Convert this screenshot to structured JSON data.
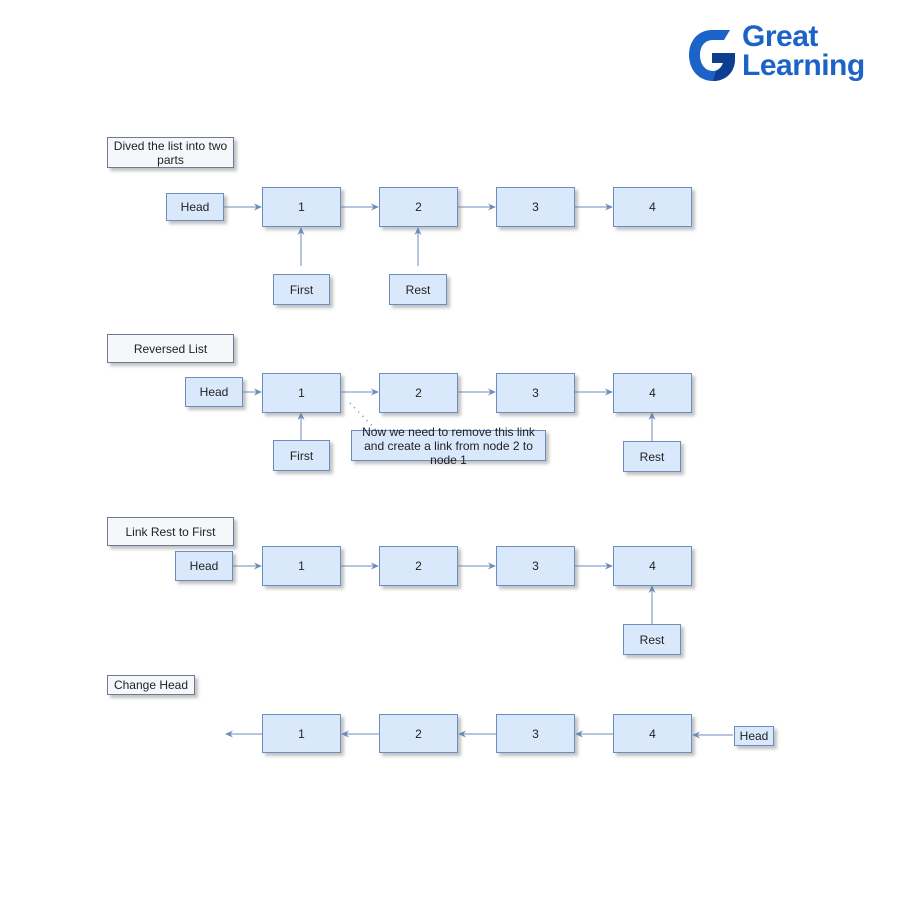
{
  "brand": {
    "name_line1": "Great",
    "name_line2": "Learning",
    "logo_icon": "g-logo-icon",
    "colors": {
      "primary": "#1c63c7",
      "dark": "#0f3d8f",
      "light": "#2b86e8"
    }
  },
  "colors": {
    "node_fill": "#dae8fc",
    "node_stroke": "#6c8ebf",
    "caption_fill": "#f5f7fb",
    "edge": "#6c8ebf"
  },
  "sections": [
    {
      "caption": "Dived the list into two parts",
      "head_label": "Head",
      "nodes": [
        "1",
        "2",
        "3",
        "4"
      ],
      "pointers": [
        {
          "label": "First",
          "target_node": "1"
        },
        {
          "label": "Rest",
          "target_node": "2"
        }
      ]
    },
    {
      "caption": "Reversed List",
      "head_label": "Head",
      "nodes": [
        "1",
        "2",
        "3",
        "4"
      ],
      "pointers": [
        {
          "label": "First",
          "target_node": "1"
        },
        {
          "label": "Rest",
          "target_node": "4"
        }
      ],
      "annotation": "Now we need to remove this link and create a link from node 2 to node 1"
    },
    {
      "caption": "Link Rest to First",
      "head_label": "Head",
      "nodes": [
        "1",
        "2",
        "3",
        "4"
      ],
      "pointers": [
        {
          "label": "Rest",
          "target_node": "4"
        }
      ]
    },
    {
      "caption": "Change Head",
      "head_label": "Head",
      "nodes": [
        "1",
        "2",
        "3",
        "4"
      ],
      "direction": "reversed",
      "pointers": []
    }
  ]
}
